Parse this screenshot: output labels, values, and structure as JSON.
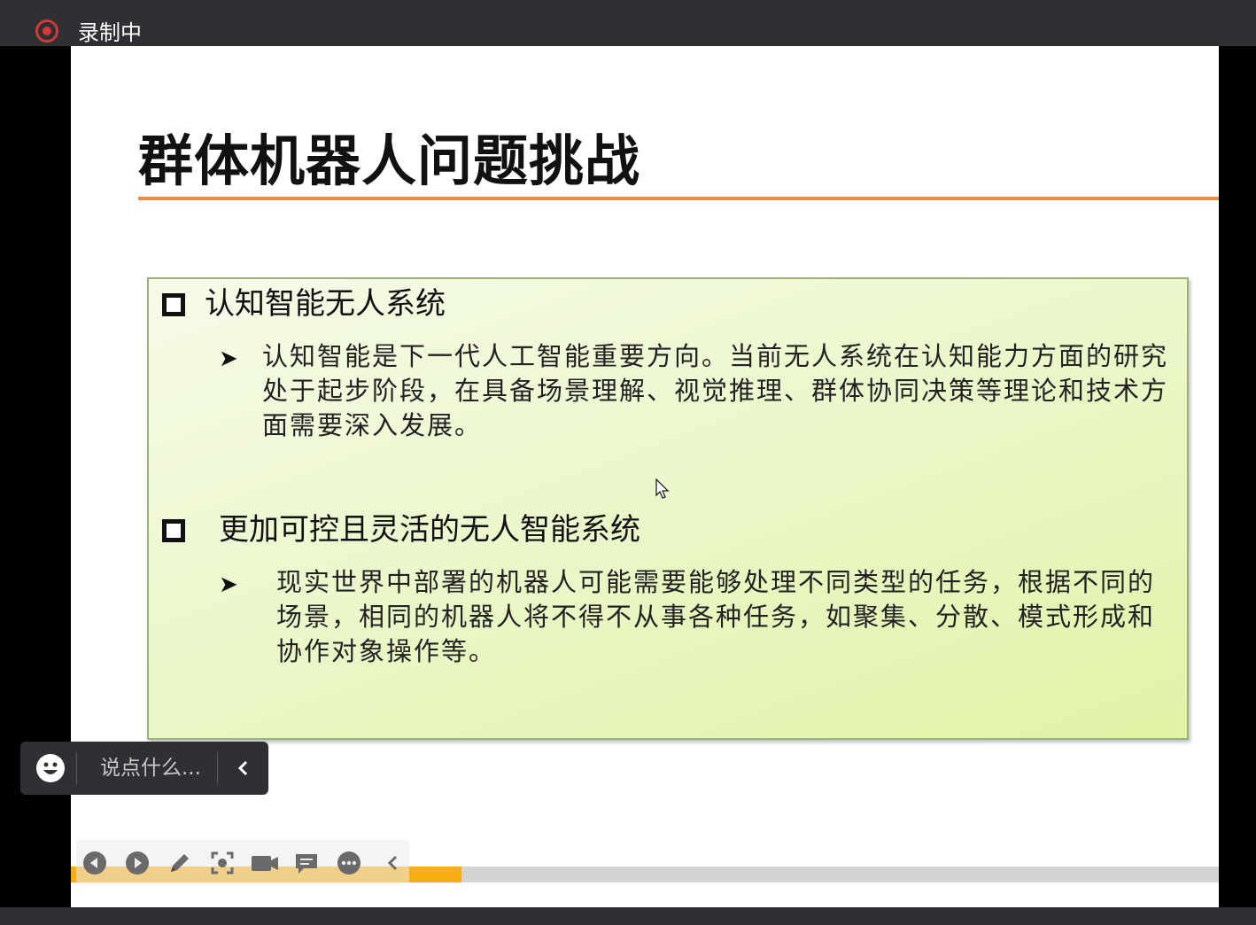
{
  "recording": {
    "label": "录制中",
    "indicator_color": "#d43a35"
  },
  "slide": {
    "title": "群体机器人问题挑战",
    "accent_color": "#ef8a40",
    "sections": [
      {
        "heading": "认知智能无人系统",
        "bullet": "认知智能是下一代人工智能重要方向。当前无人系统在认知能力方面的研究处于起步阶段，在具备场景理解、视觉推理、群体协同决策等理论和技术方面需要深入发展。"
      },
      {
        "heading": "更加可控且灵活的无人智能系统",
        "bullet": "现实世界中部署的机器人可能需要能够处理不同类型的任务，根据不同的场景，相同的机器人将不得不从事各种任务，如聚集、分散、模式形成和协作对象操作等。"
      }
    ]
  },
  "comment": {
    "placeholder": "说点什么...",
    "emoji_icon": "emoji-icon",
    "collapse_icon": "chevron-left-icon"
  },
  "player": {
    "progress_fraction": 0.34,
    "progress_color": "#f5ad11",
    "toolbar_icons": [
      "previous-icon",
      "next-icon",
      "pen-icon",
      "screenshot-icon",
      "camera-icon",
      "comment-icon",
      "more-icon",
      "collapse-icon"
    ]
  }
}
